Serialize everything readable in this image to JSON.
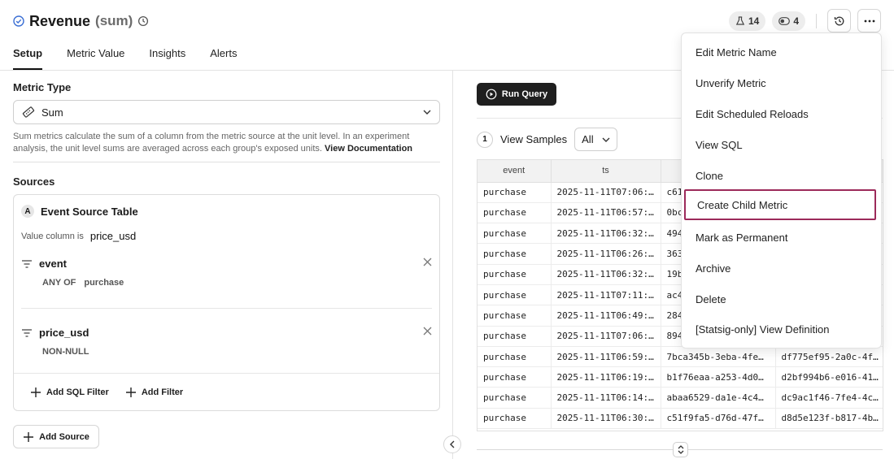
{
  "header": {
    "title": "Revenue",
    "aggregation": "(sum)",
    "badges": [
      {
        "icon": "flask-icon",
        "count": "14"
      },
      {
        "icon": "toggle-icon",
        "count": "4"
      }
    ]
  },
  "tabs": [
    "Setup",
    "Metric Value",
    "Insights",
    "Alerts"
  ],
  "active_tab": "Setup",
  "setup": {
    "metric_type_label": "Metric Type",
    "metric_type_value": "Sum",
    "helper_text": "Sum metrics calculate the sum of a column from the metric source at the unit level. In an experiment analysis, the unit level sums are averaged across each group's exposed units.",
    "helper_link": "View Documentation",
    "sources_label": "Sources",
    "source": {
      "badge": "A",
      "name": "Event Source Table",
      "value_column_label": "Value column is",
      "value_column": "price_usd",
      "filters": [
        {
          "field": "event",
          "operator": "ANY OF",
          "value": "purchase"
        },
        {
          "field": "price_usd",
          "operator": "NON-NULL",
          "value": ""
        }
      ],
      "add_sql_filter": "Add SQL Filter",
      "add_filter": "Add Filter"
    },
    "add_source": "Add Source"
  },
  "query": {
    "run_button": "Run Query",
    "samples_count": "1",
    "samples_label": "View Samples",
    "samples_filter": "All",
    "columns": [
      "event",
      "ts",
      "",
      ""
    ],
    "rows": [
      [
        "purchase",
        "2025-11-11T07:06:…",
        "c61",
        ""
      ],
      [
        "purchase",
        "2025-11-11T06:57:…",
        "0bc",
        ""
      ],
      [
        "purchase",
        "2025-11-11T06:32:…",
        "494",
        ""
      ],
      [
        "purchase",
        "2025-11-11T06:26:…",
        "363",
        ""
      ],
      [
        "purchase",
        "2025-11-11T06:32:…",
        "19b",
        ""
      ],
      [
        "purchase",
        "2025-11-11T07:11:…",
        "ac4",
        ""
      ],
      [
        "purchase",
        "2025-11-11T06:49:…",
        "284",
        ""
      ],
      [
        "purchase",
        "2025-11-11T07:06:…",
        "894",
        ""
      ],
      [
        "purchase",
        "2025-11-11T06:59:…",
        "7bca345b-3eba-4fe…",
        "df775ef95-2a0c-4f…"
      ],
      [
        "purchase",
        "2025-11-11T06:19:…",
        "b1f76eaa-a253-4d0…",
        "d2bf994b6-e016-41…"
      ],
      [
        "purchase",
        "2025-11-11T06:14:…",
        "abaa6529-da1e-4c4…",
        "dc9ac1f46-7fe4-4c…"
      ],
      [
        "purchase",
        "2025-11-11T06:30:…",
        "c51f9fa5-d76d-47f…",
        "d8d5e123f-b817-4b…"
      ]
    ]
  },
  "menu": {
    "items": [
      "Edit Metric Name",
      "Unverify Metric",
      "Edit Scheduled Reloads",
      "View SQL",
      "Clone",
      "Create Child Metric",
      "Mark as Permanent",
      "Archive",
      "Delete",
      "[Statsig-only] View Definition"
    ],
    "highlighted": "Create Child Metric"
  },
  "colors": {
    "highlight_border": "#9c2a5a",
    "verified_icon": "#3b6fd4",
    "run_button_bg": "#1f1f1f"
  }
}
